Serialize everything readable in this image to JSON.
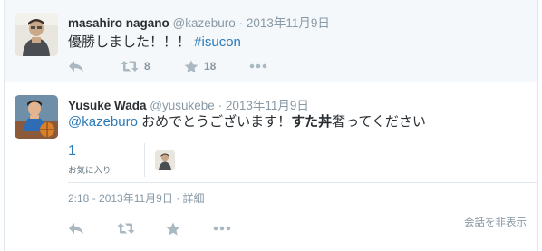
{
  "parent_tweet": {
    "fullname": "masahiro nagano",
    "handle": "@kazeburo",
    "separator": "·",
    "time": "2013年11月9日",
    "text_main": "優勝しました！！！ ",
    "hashtag": "#isucon",
    "retweet_count": "8",
    "favorite_count": "18"
  },
  "focus_tweet": {
    "fullname": "Yusuke Wada",
    "handle": "@yusukebe",
    "separator": "·",
    "time": "2013年11月9日",
    "mention": "@kazeburo",
    "text_main": " おめでとうございます！",
    "text_bold": "すた丼",
    "text_tail": "奢ってください",
    "favorites_number": "1",
    "favorites_label": "お気に入り",
    "timestamp": "2:18 - 2013年11月9日",
    "meta_separator": " · ",
    "details_link": "詳細",
    "hide_conversation": "会話を非表示"
  },
  "colors": {
    "link": "#2b7bb9",
    "muted": "#8899a6",
    "icon": "#aab8c2",
    "parent_bg": "#f5f8fa",
    "border": "#e1e8ed"
  },
  "icons": [
    "reply-icon",
    "retweet-icon",
    "favorite-icon",
    "more-icon"
  ]
}
